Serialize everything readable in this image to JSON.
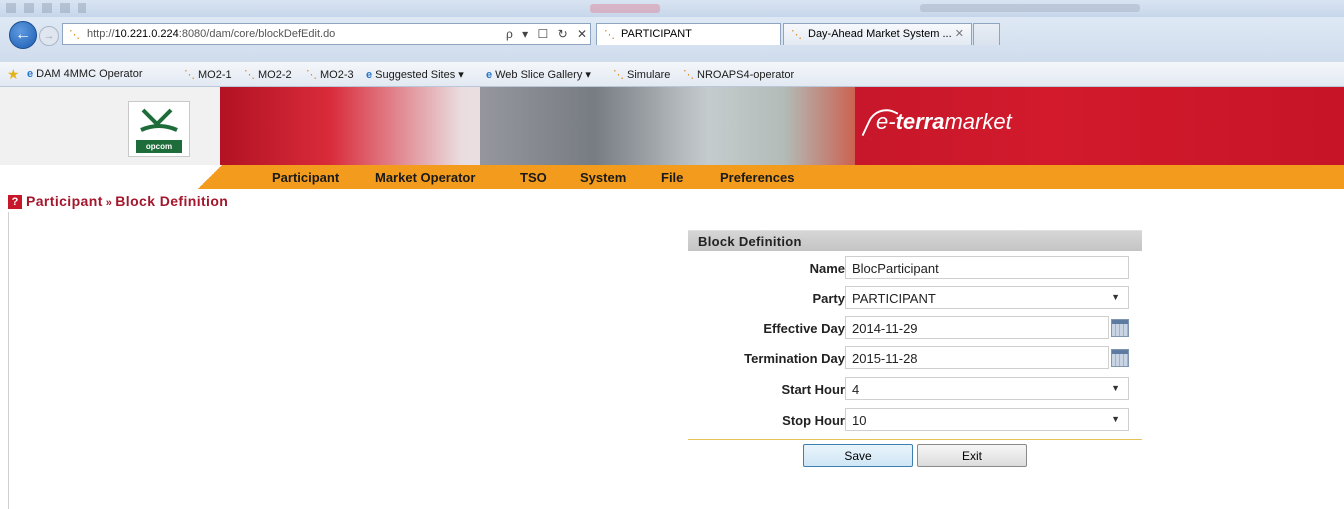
{
  "browser": {
    "url_prefix": "http://",
    "url_host": "10.221.0.224",
    "url_path": ":8080/dam/core/blockDefEdit.do",
    "address_tools": "ρ ▾ ☐ ↻ ✕",
    "tabs": [
      {
        "label": "PARTICIPANT",
        "close": ""
      },
      {
        "label": "Day-Ahead Market System ...",
        "close": "✕"
      }
    ],
    "favorites": [
      "DAM 4MMC Operator",
      "MO2-1",
      "MO2-2",
      "MO2-3",
      "Suggested Sites ▾",
      "Web Slice Gallery ▾",
      "Simulare",
      "NROAPS4-operator"
    ]
  },
  "header": {
    "logo_text": "opcom",
    "brand_prefix": "e-",
    "brand_bold": "terra",
    "brand_suffix": "market"
  },
  "menu": [
    "Participant",
    "Market Operator",
    "TSO",
    "System",
    "File",
    "Preferences"
  ],
  "breadcrumb": {
    "help": "?",
    "parent": "Participant",
    "separator": "»",
    "current": "Block Definition"
  },
  "form": {
    "title": "Block Definition",
    "fields": {
      "name": {
        "label": "Name",
        "value": "BlocParticipant"
      },
      "party": {
        "label": "Party",
        "value": "PARTICIPANT"
      },
      "effective_day": {
        "label": "Effective Day",
        "value": "2014-11-29"
      },
      "termination_day": {
        "label": "Termination Day",
        "value": "2015-11-28"
      },
      "start_hour": {
        "label": "Start Hour",
        "value": "4"
      },
      "stop_hour": {
        "label": "Stop Hour",
        "value": "10"
      }
    },
    "save_label": "Save",
    "exit_label": "Exit"
  }
}
